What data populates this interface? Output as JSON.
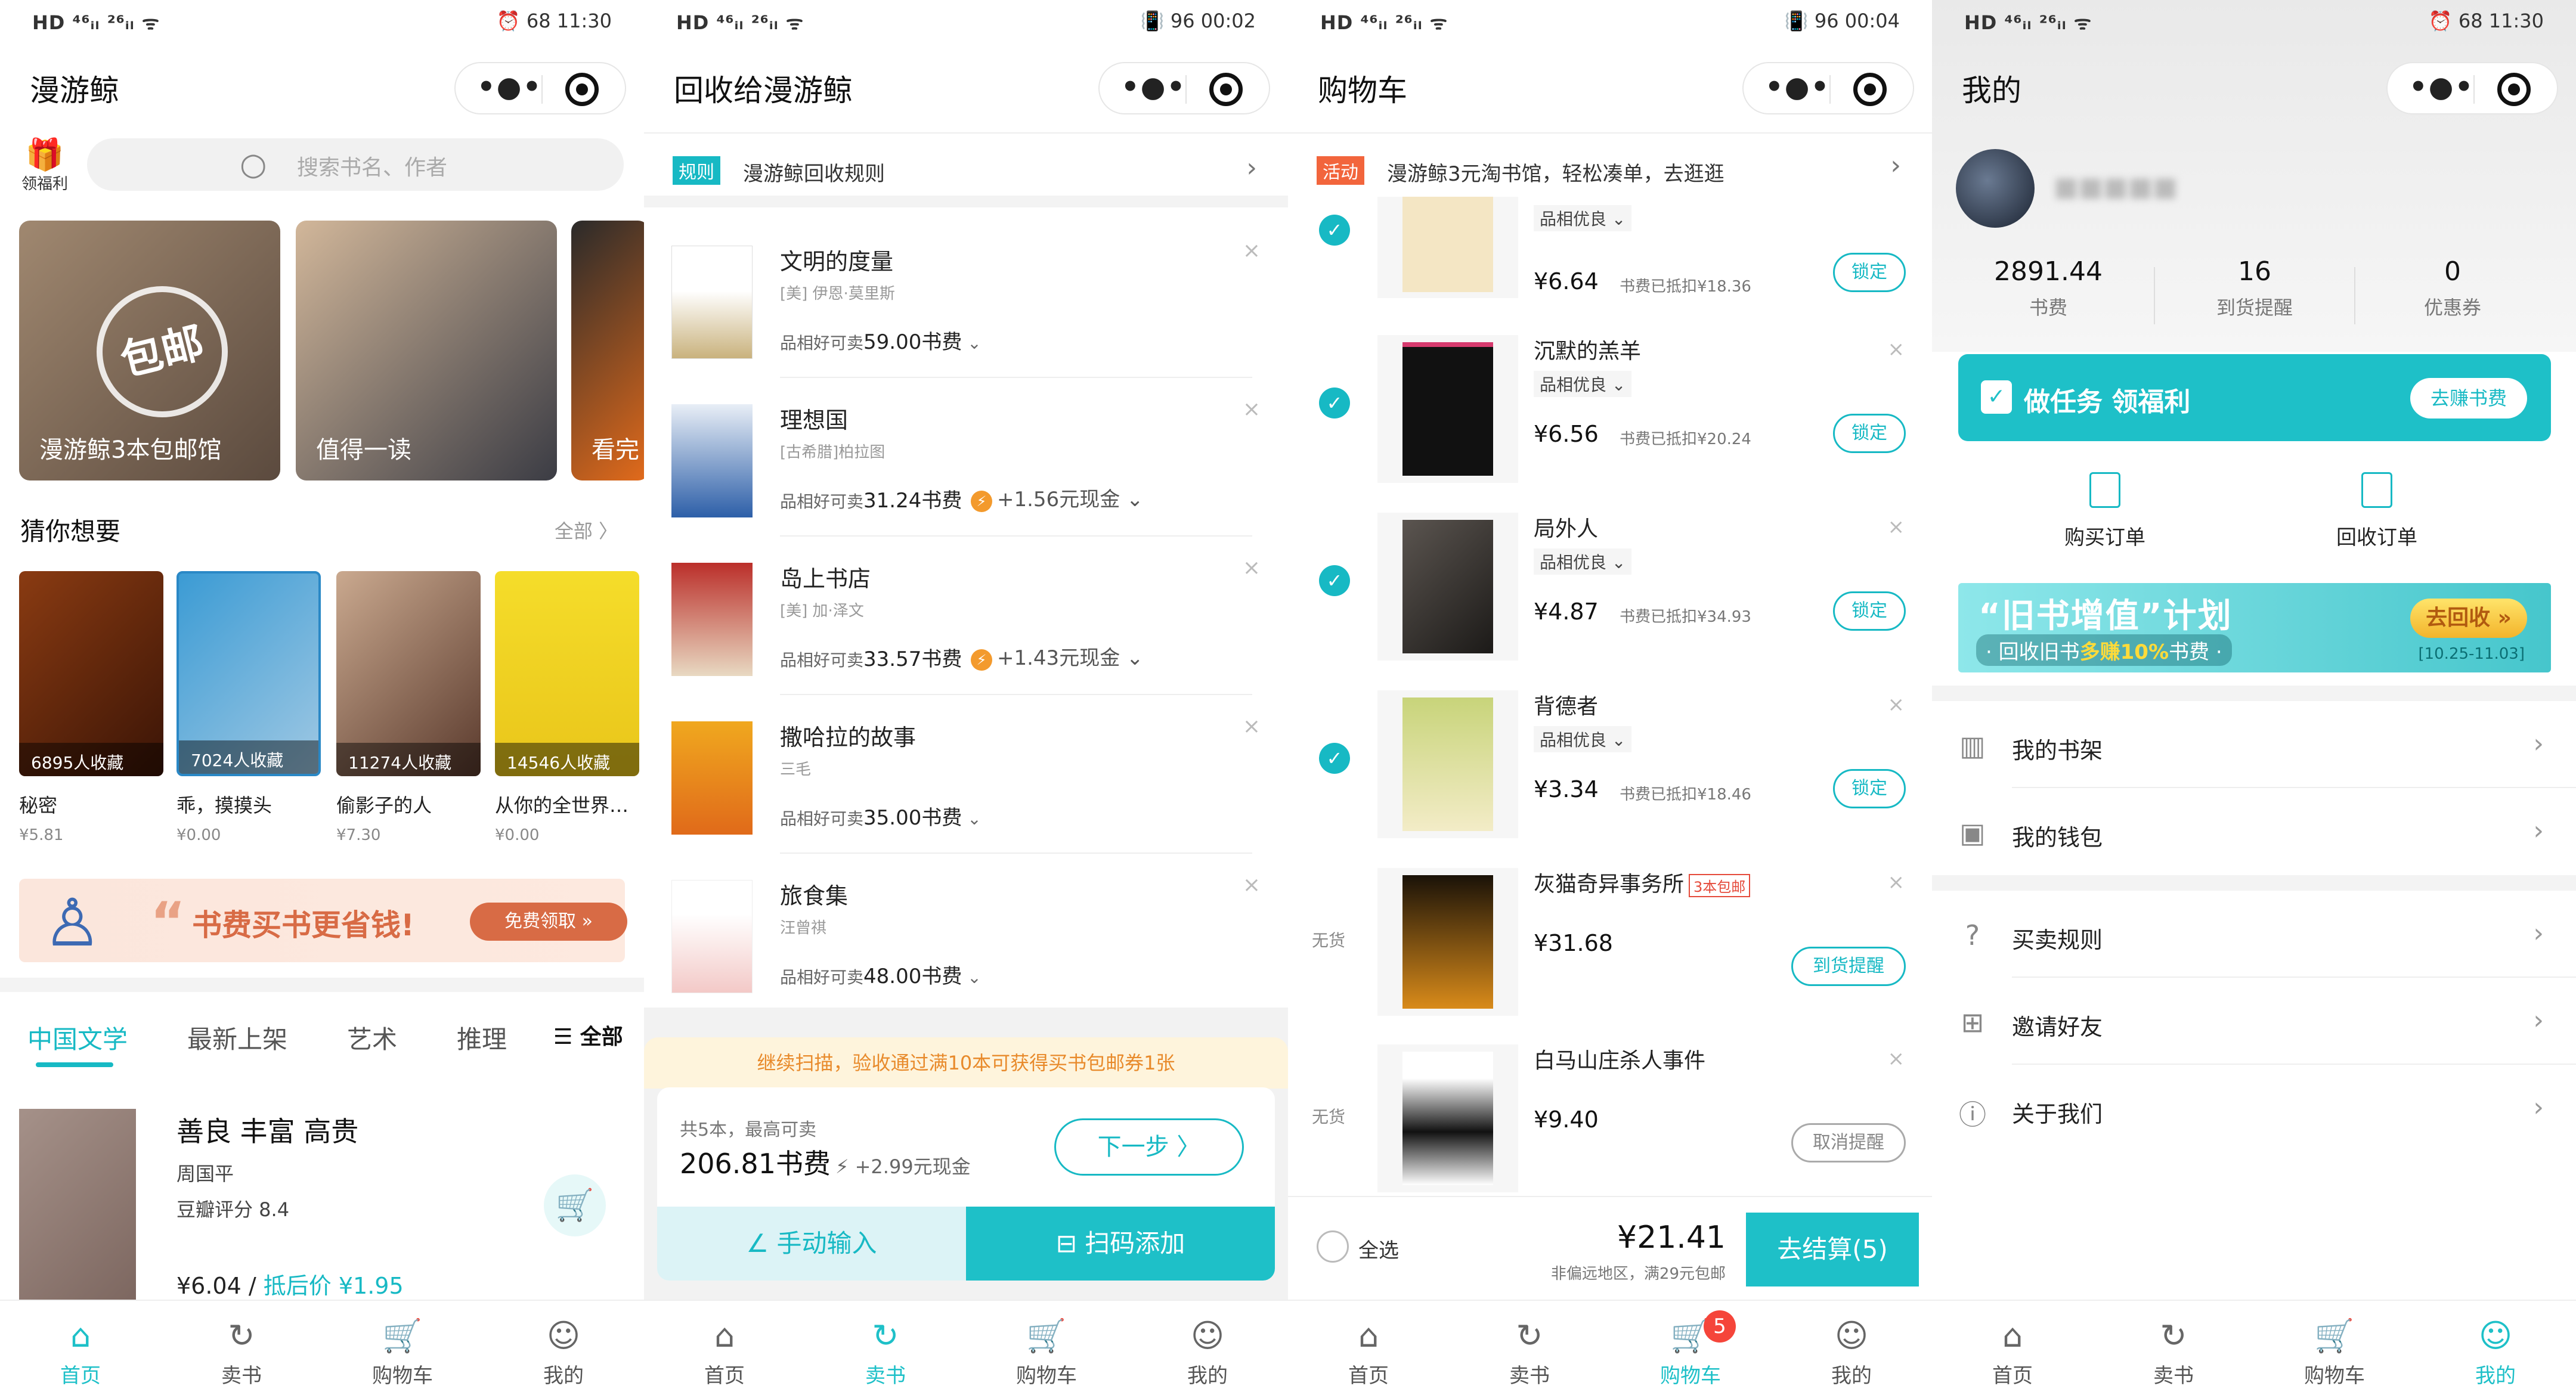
{
  "status_bars": [
    {
      "left": "HD ⁴⁶ᵢₗ ²⁶ᵢₗ ᯤ",
      "right": "⏰ 68 11:30"
    },
    {
      "left": "HD ⁴⁶ᵢₗ ²⁶ᵢₗ ᯤ",
      "right": "📳 96 00:02"
    },
    {
      "left": "HD ⁴⁶ᵢₗ ²⁶ᵢₗ ᯤ",
      "right": "📳 96 00:04"
    },
    {
      "left": "HD ⁴⁶ᵢₗ ²⁶ᵢₗ ᯤ",
      "right": "⏰ 68 11:30"
    }
  ],
  "capsule": {
    "more": "•●•",
    "close": ""
  },
  "tabbar": {
    "home": "首页",
    "sell": "卖书",
    "cart": "购物车",
    "me": "我的",
    "cart_badge": "5"
  },
  "home": {
    "title": "漫游鲸",
    "gift_label": "领福利",
    "search_placeholder": "搜索书名、作者",
    "banners": [
      "漫游鲸3本包邮馆",
      "值得一读",
      "看完"
    ],
    "banner_stamp": "包邮",
    "section_title": "猜你想要",
    "section_all": "全部 〉",
    "books": [
      {
        "name": "秘密",
        "price": "¥5.81",
        "count": "6895人收藏"
      },
      {
        "name": "乖，摸摸头",
        "price": "¥0.00",
        "count": "7024人收藏"
      },
      {
        "name": "偷影子的人",
        "price": "¥7.30",
        "count": "11274人收藏"
      },
      {
        "name": "从你的全世界…",
        "price": "¥0.00",
        "count": "14546人收藏"
      }
    ],
    "promo": {
      "text": "书费买书更省钱!",
      "button": "免费领取 »"
    },
    "cat_tabs": [
      "中国文学",
      "最新上架",
      "艺术",
      "推理"
    ],
    "cat_all": "☰ 全部",
    "featured": {
      "title": "善良 丰富 高贵",
      "author": "周国平",
      "rating": "豆瓣评分 8.4",
      "price": "¥6.04",
      "deduct": "抵后价 ¥1.95"
    }
  },
  "sell": {
    "title": "回收给漫游鲸",
    "rule_tag": "规则",
    "rule_text": "漫游鲸回收规则",
    "items": [
      {
        "name": "文明的度量",
        "author": "[美] 伊恩·莫里斯",
        "sell_label": "品相好可卖",
        "amount": "59.00书费",
        "cash": ""
      },
      {
        "name": "理想国",
        "author": "[古希腊]柏拉图",
        "sell_label": "品相好可卖",
        "amount": "31.24书费",
        "cash": "+1.56元现金"
      },
      {
        "name": "岛上书店",
        "author": "[美] 加·泽文",
        "sell_label": "品相好可卖",
        "amount": "33.57书费",
        "cash": "+1.43元现金"
      },
      {
        "name": "撒哈拉的故事",
        "author": "三毛",
        "sell_label": "品相好可卖",
        "amount": "35.00书费",
        "cash": ""
      },
      {
        "name": "旅食集",
        "author": "汪曾祺",
        "sell_label": "品相好可卖",
        "amount": "48.00书费",
        "cash": ""
      }
    ],
    "notice": "继续扫描，验收通过满10本可获得买书包邮券1张",
    "summary_label": "共5本，最高可卖",
    "summary_value": "206.81书费",
    "summary_cash": "+2.99元现金",
    "next_button": "下一步 〉",
    "manual_button": "∠ 手动输入",
    "scan_button": "⊟ 扫码添加"
  },
  "cart": {
    "title": "购物车",
    "act_tag": "活动",
    "act_text": "漫游鲸3元淘书馆，轻松凑单，去逛逛",
    "items": [
      {
        "name": "",
        "cond": "品相优良 ⌄",
        "price": "¥6.64",
        "deduct": "书费已抵扣¥18.36",
        "btn": "锁定",
        "state": "checked"
      },
      {
        "name": "沉默的羔羊",
        "cond": "品相优良 ⌄",
        "price": "¥6.56",
        "deduct": "书费已抵扣¥20.24",
        "btn": "锁定",
        "state": "checked"
      },
      {
        "name": "局外人",
        "cond": "品相优良 ⌄",
        "price": "¥4.87",
        "deduct": "书费已抵扣¥34.93",
        "btn": "锁定",
        "state": "checked"
      },
      {
        "name": "背德者",
        "cond": "品相优良 ⌄",
        "price": "¥3.34",
        "deduct": "书费已抵扣¥18.46",
        "btn": "锁定",
        "state": "checked"
      },
      {
        "name": "灰猫奇异事务所",
        "pack": "3本包邮",
        "cond": "",
        "price": "¥31.68",
        "deduct": "",
        "btn": "到货提醒",
        "state": "无货"
      },
      {
        "name": "白马山庄杀人事件",
        "cond": "",
        "price": "¥9.40",
        "deduct": "",
        "btn": "取消提醒",
        "state": "无货"
      }
    ],
    "select_all": "全选",
    "total": "¥21.41",
    "shipping_note": "非偏远地区，满29元包邮",
    "checkout": "去结算(5)"
  },
  "me": {
    "title": "我的",
    "stats": [
      {
        "value": "2891.44",
        "label": "书费"
      },
      {
        "value": "16",
        "label": "到货提醒"
      },
      {
        "value": "0",
        "label": "优惠券"
      }
    ],
    "task_text": "做任务 领福利",
    "task_button": "去赚书费",
    "orders": [
      "购买订单",
      "回收订单"
    ],
    "oldbook": {
      "title": "“旧书增值”计划",
      "sub_a": "· 回收旧书",
      "sub_b": "多赚10%",
      "sub_c": "书费 ·",
      "button": "去回收 »",
      "dates": "[10.25-11.03]"
    },
    "menu": [
      "我的书架",
      "我的钱包",
      "买卖规则",
      "邀请好友",
      "关于我们"
    ]
  },
  "colors": {
    "accent": "#1ec0c8",
    "promo": "#d86b45",
    "activity": "#f2653c",
    "badge": "#f5453a"
  }
}
